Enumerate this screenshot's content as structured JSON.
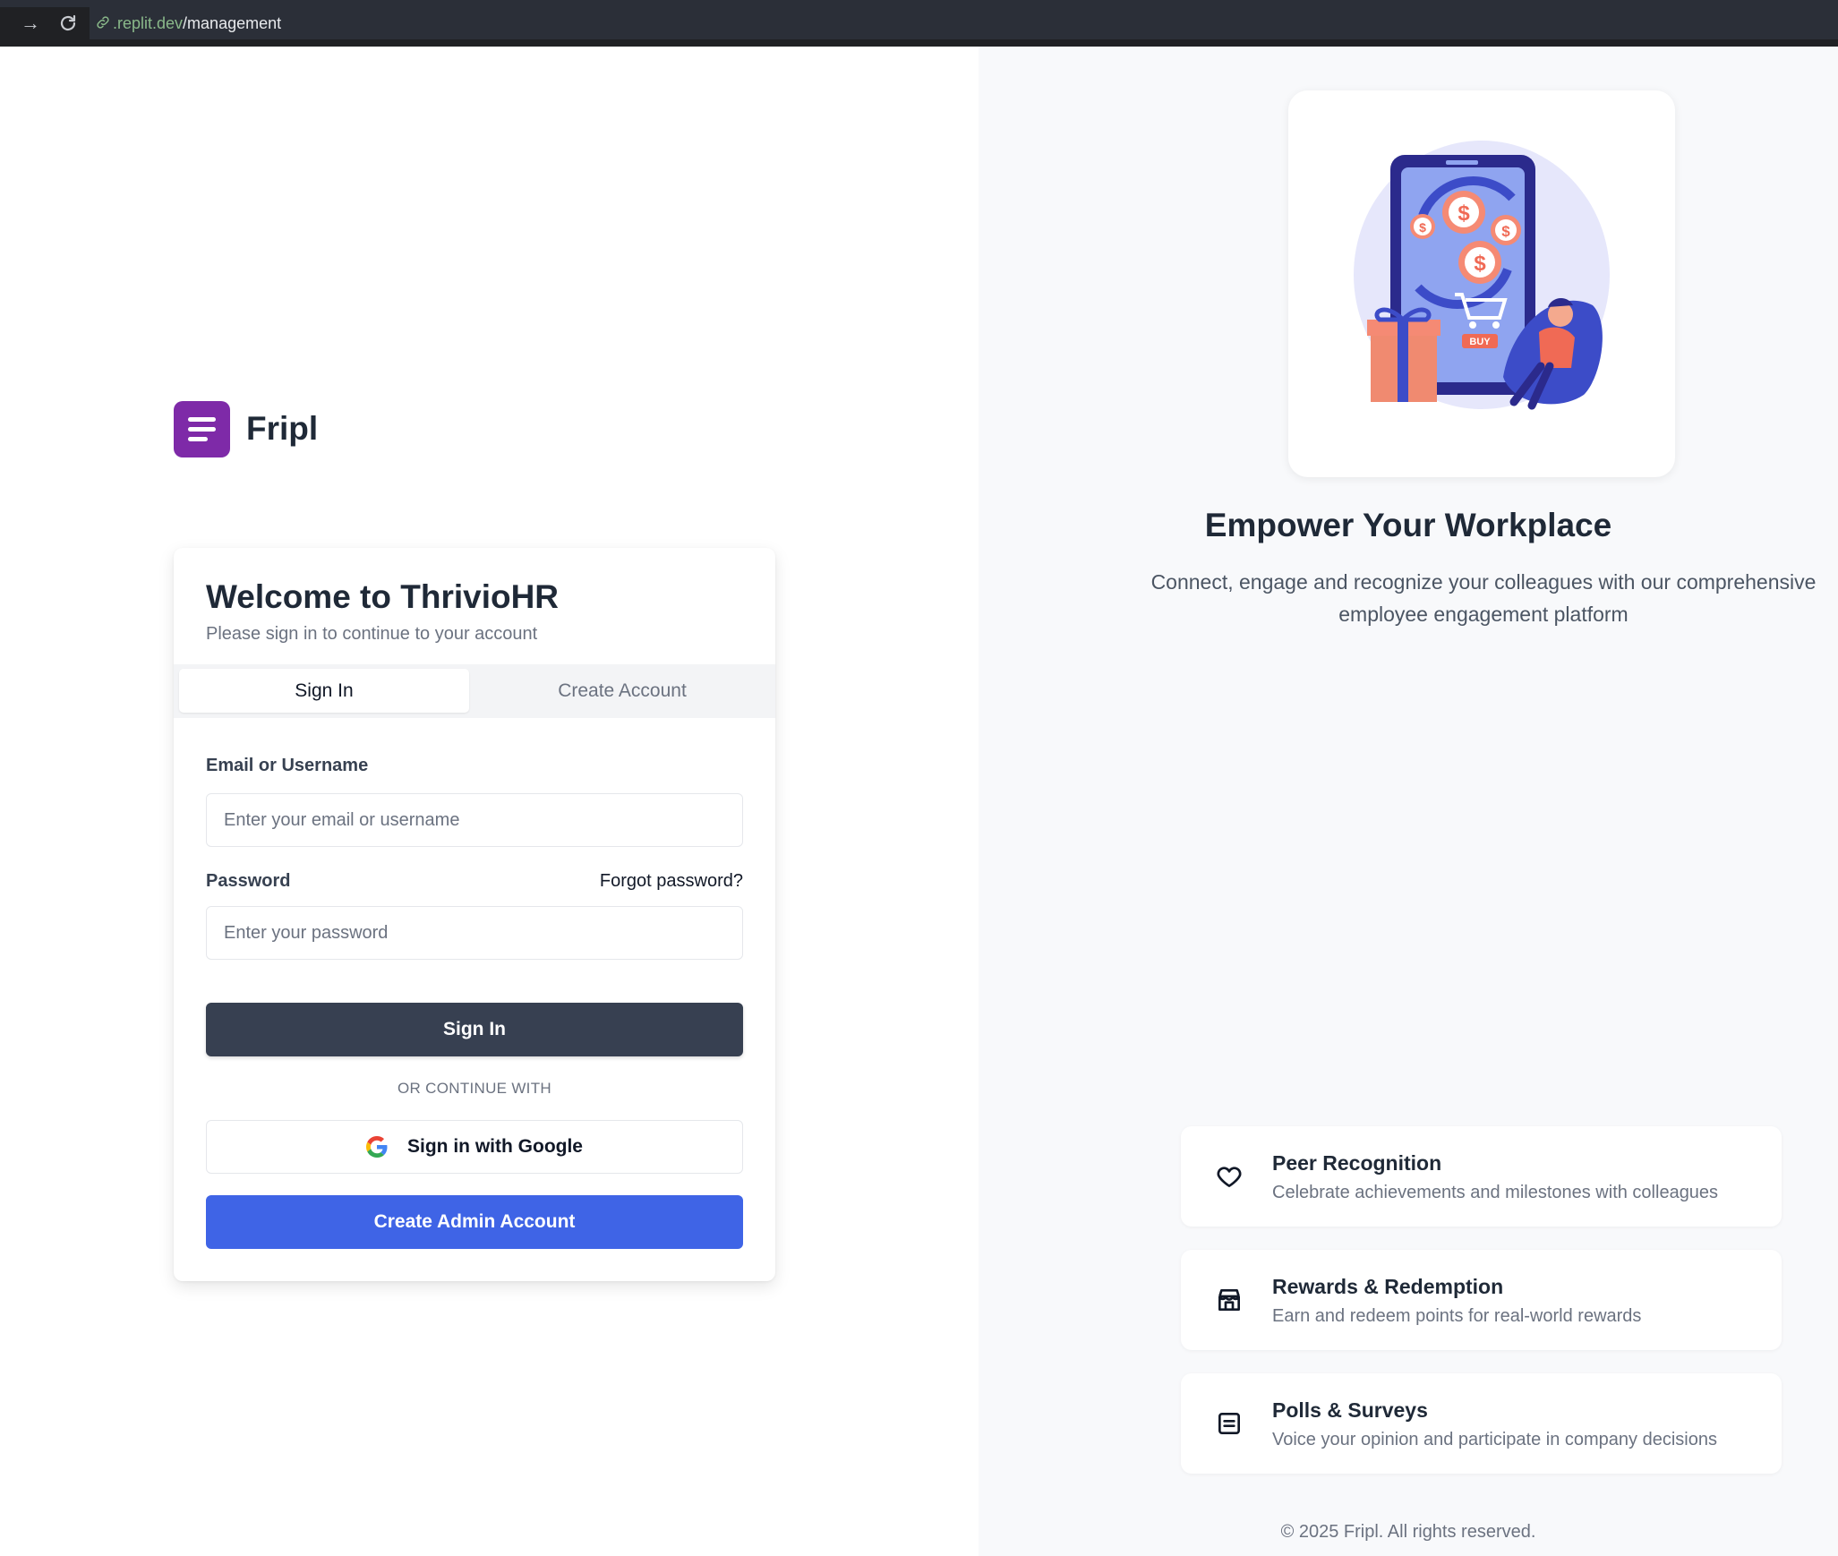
{
  "browser": {
    "url_host": ".replit.dev",
    "url_path": "/management"
  },
  "brand": {
    "name": "Fripl"
  },
  "login": {
    "title": "Welcome to ThrivioHR",
    "subtitle": "Please sign in to continue to your account",
    "tabs": [
      {
        "label": "Sign In",
        "active": true
      },
      {
        "label": "Create Account",
        "active": false
      }
    ],
    "email_label": "Email or Username",
    "email_placeholder": "Enter your email or username",
    "password_label": "Password",
    "forgot_label": "Forgot password?",
    "password_placeholder": "Enter your password",
    "submit_label": "Sign In",
    "divider_label": "OR CONTINUE WITH",
    "google_label": "Sign in with Google",
    "admin_label": "Create Admin Account"
  },
  "hero": {
    "title": "Empower Your Workplace",
    "description": "Connect, engage and recognize your colleagues with our comprehensive employee engagement platform",
    "illustration_badge": "BUY"
  },
  "features": [
    {
      "icon": "heart-icon",
      "title": "Peer Recognition",
      "description": "Celebrate achievements and milestones with colleagues"
    },
    {
      "icon": "store-icon",
      "title": "Rewards & Redemption",
      "description": "Earn and redeem points for real-world rewards"
    },
    {
      "icon": "list-icon",
      "title": "Polls & Surveys",
      "description": "Voice your opinion and participate in company decisions"
    }
  ],
  "footer": {
    "copyright": "© 2025 Fripl. All rights reserved."
  },
  "colors": {
    "brand": "#7e2aa8",
    "primary_button": "#374051",
    "admin_button": "#3f64e6",
    "right_panel_bg": "#f8f9fb"
  }
}
